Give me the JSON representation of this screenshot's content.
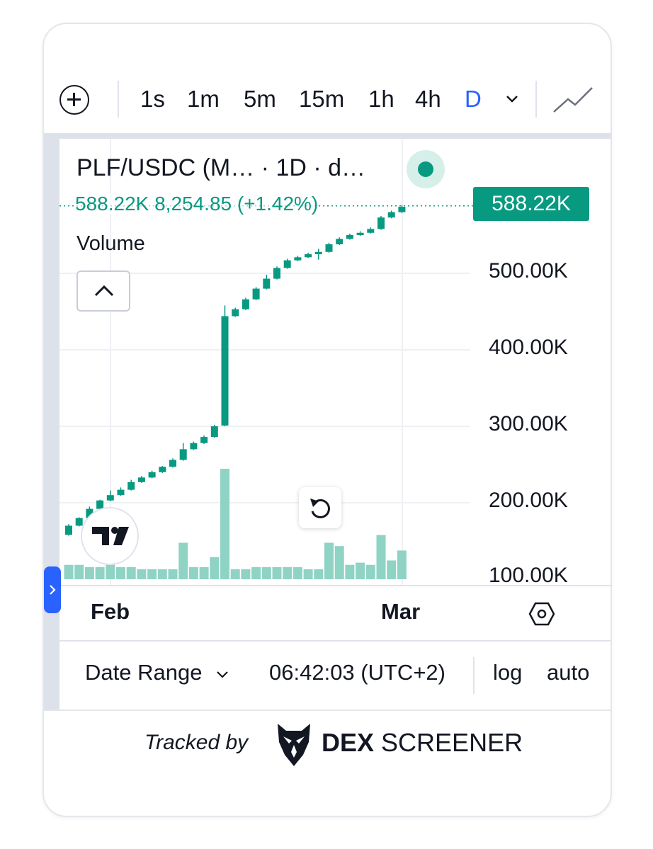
{
  "toolbar": {
    "intervals": [
      "1s",
      "1m",
      "5m",
      "15m",
      "1h",
      "4h",
      "D"
    ],
    "active_interval": "D"
  },
  "legend": {
    "title": "PLF/USDC (M… · 1D · d…",
    "ohlc": "588.22K  8,254.85 (+1.42%)",
    "volume_label": "Volume"
  },
  "price_tag": "588.22K",
  "colors": {
    "up": "#089981",
    "volume": "#8fd3c4",
    "active": "#2962ff"
  },
  "chart_data": {
    "type": "candlestick",
    "y_ticks": [
      "500.00K",
      "400.00K",
      "300.00K",
      "200.00K",
      "100.00K"
    ],
    "x_ticks": [
      "Feb",
      "Mar"
    ],
    "last_price": 588220,
    "ylim": [
      100000,
      600000
    ],
    "candles": [
      {
        "o": 158000,
        "c": 170000,
        "h": 172000,
        "l": 157000,
        "v": 0.13
      },
      {
        "o": 170000,
        "c": 180000,
        "h": 181000,
        "l": 169000,
        "v": 0.13
      },
      {
        "o": 180000,
        "c": 192000,
        "h": 195000,
        "l": 179000,
        "v": 0.11
      },
      {
        "o": 192000,
        "c": 203000,
        "h": 204000,
        "l": 191000,
        "v": 0.11
      },
      {
        "o": 203000,
        "c": 210000,
        "h": 216000,
        "l": 202000,
        "v": 0.15
      },
      {
        "o": 210000,
        "c": 217000,
        "h": 220000,
        "l": 209000,
        "v": 0.11
      },
      {
        "o": 217000,
        "c": 227000,
        "h": 230000,
        "l": 216000,
        "v": 0.11
      },
      {
        "o": 227000,
        "c": 233000,
        "h": 235000,
        "l": 226000,
        "v": 0.09
      },
      {
        "o": 233000,
        "c": 240000,
        "h": 242000,
        "l": 232000,
        "v": 0.09
      },
      {
        "o": 240000,
        "c": 247000,
        "h": 248000,
        "l": 239000,
        "v": 0.09
      },
      {
        "o": 247000,
        "c": 256000,
        "h": 258000,
        "l": 246000,
        "v": 0.09
      },
      {
        "o": 256000,
        "c": 270000,
        "h": 278000,
        "l": 255000,
        "v": 0.33
      },
      {
        "o": 270000,
        "c": 278000,
        "h": 280000,
        "l": 269000,
        "v": 0.11
      },
      {
        "o": 278000,
        "c": 286000,
        "h": 288000,
        "l": 277000,
        "v": 0.11
      },
      {
        "o": 286000,
        "c": 300000,
        "h": 302000,
        "l": 285000,
        "v": 0.2
      },
      {
        "o": 301000,
        "c": 444000,
        "h": 458000,
        "l": 300000,
        "v": 1.0
      },
      {
        "o": 444000,
        "c": 453000,
        "h": 455000,
        "l": 443000,
        "v": 0.09
      },
      {
        "o": 453000,
        "c": 466000,
        "h": 468000,
        "l": 452000,
        "v": 0.09
      },
      {
        "o": 466000,
        "c": 480000,
        "h": 482000,
        "l": 465000,
        "v": 0.11
      },
      {
        "o": 480000,
        "c": 493000,
        "h": 498000,
        "l": 479000,
        "v": 0.11
      },
      {
        "o": 493000,
        "c": 507000,
        "h": 509000,
        "l": 492000,
        "v": 0.11
      },
      {
        "o": 507000,
        "c": 517000,
        "h": 519000,
        "l": 506000,
        "v": 0.11
      },
      {
        "o": 517000,
        "c": 521000,
        "h": 523000,
        "l": 516000,
        "v": 0.11
      },
      {
        "o": 521000,
        "c": 525000,
        "h": 527000,
        "l": 520000,
        "v": 0.09
      },
      {
        "o": 525000,
        "c": 528000,
        "h": 532000,
        "l": 518000,
        "v": 0.09
      },
      {
        "o": 528000,
        "c": 538000,
        "h": 540000,
        "l": 527000,
        "v": 0.33
      },
      {
        "o": 538000,
        "c": 545000,
        "h": 547000,
        "l": 537000,
        "v": 0.3
      },
      {
        "o": 545000,
        "c": 550000,
        "h": 552000,
        "l": 544000,
        "v": 0.13
      },
      {
        "o": 550000,
        "c": 553000,
        "h": 555000,
        "l": 549000,
        "v": 0.15
      },
      {
        "o": 553000,
        "c": 558000,
        "h": 560000,
        "l": 552000,
        "v": 0.13
      },
      {
        "o": 558000,
        "c": 573000,
        "h": 575000,
        "l": 557000,
        "v": 0.4
      },
      {
        "o": 573000,
        "c": 580000,
        "h": 582000,
        "l": 572000,
        "v": 0.17
      },
      {
        "o": 580000,
        "c": 587000,
        "h": 589000,
        "l": 579000,
        "v": 0.26
      }
    ]
  },
  "time_axis": {
    "feb": "Feb",
    "mar": "Mar"
  },
  "bottom_bar": {
    "date_range": "Date Range",
    "time": "06:42:03 (UTC+2)",
    "log": "log",
    "auto": "auto"
  },
  "footer": {
    "tracked_by": "Tracked by",
    "brand_bold": "DEX",
    "brand_rest": " SCREENER"
  }
}
